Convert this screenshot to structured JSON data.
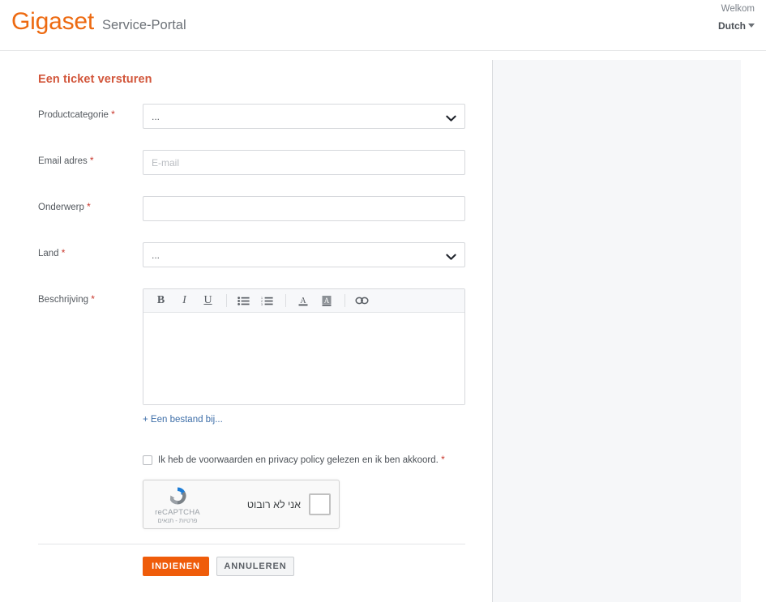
{
  "header": {
    "brand": "Gigaset",
    "brand_sub": "Service-Portal",
    "welcome": "Welkom",
    "language": "Dutch",
    "caret_icon": "chevron-down-icon"
  },
  "main": {
    "title": "Een ticket versturen",
    "fields": {
      "product_category": {
        "label": "Productcategorie",
        "required": "*",
        "value": "...",
        "caret_icon": "chevron-down-icon"
      },
      "email": {
        "label": "Email adres",
        "required": "*",
        "value": "",
        "placeholder": "E-mail"
      },
      "subject": {
        "label": "Onderwerp",
        "required": "*",
        "value": "",
        "placeholder": ""
      },
      "country": {
        "label": "Land",
        "required": "*",
        "value": "...",
        "caret_icon": "chevron-down-icon"
      },
      "description": {
        "label": "Beschrijving",
        "required": "*",
        "value": ""
      }
    },
    "editor_toolbar": [
      {
        "name": "bold-icon",
        "glyph": "B",
        "cls": "b"
      },
      {
        "name": "italic-icon",
        "glyph": "I",
        "cls": "i"
      },
      {
        "name": "underline-icon",
        "glyph": "U",
        "cls": "u"
      },
      {
        "name": "separator",
        "glyph": "",
        "cls": "sep"
      },
      {
        "name": "unordered-list-icon",
        "glyph": "",
        "cls": "ul"
      },
      {
        "name": "ordered-list-icon",
        "glyph": "",
        "cls": "ol"
      },
      {
        "name": "separator",
        "glyph": "",
        "cls": "sep"
      },
      {
        "name": "text-color-icon",
        "glyph": "",
        "cls": "fc"
      },
      {
        "name": "background-color-icon",
        "glyph": "",
        "cls": "bc"
      },
      {
        "name": "separator",
        "glyph": "",
        "cls": "sep"
      },
      {
        "name": "link-icon",
        "glyph": "",
        "cls": "lk"
      }
    ],
    "attachment_link": "+ Een bestand bij...",
    "consent": {
      "text": "Ik heb de voorwaarden en privacy policy gelezen en ik ben akkoord.",
      "required": "*",
      "checked": false
    },
    "recaptcha": {
      "label": "אני לא רובוט",
      "brand": "reCAPTCHA",
      "fine_print": "פרטיות - תנאים",
      "logo_icon": "recaptcha-logo-icon",
      "checked": false
    },
    "buttons": {
      "submit": "INDIENEN",
      "cancel": "ANNULEREN"
    }
  },
  "colors": {
    "brand_orange": "#ed6a11",
    "title_red": "#d2563b",
    "submit_orange": "#ef5c0a",
    "required_red": "#c9372c",
    "side_panel_bg": "#f6f7f9",
    "link_blue": "#3d6ea8"
  }
}
